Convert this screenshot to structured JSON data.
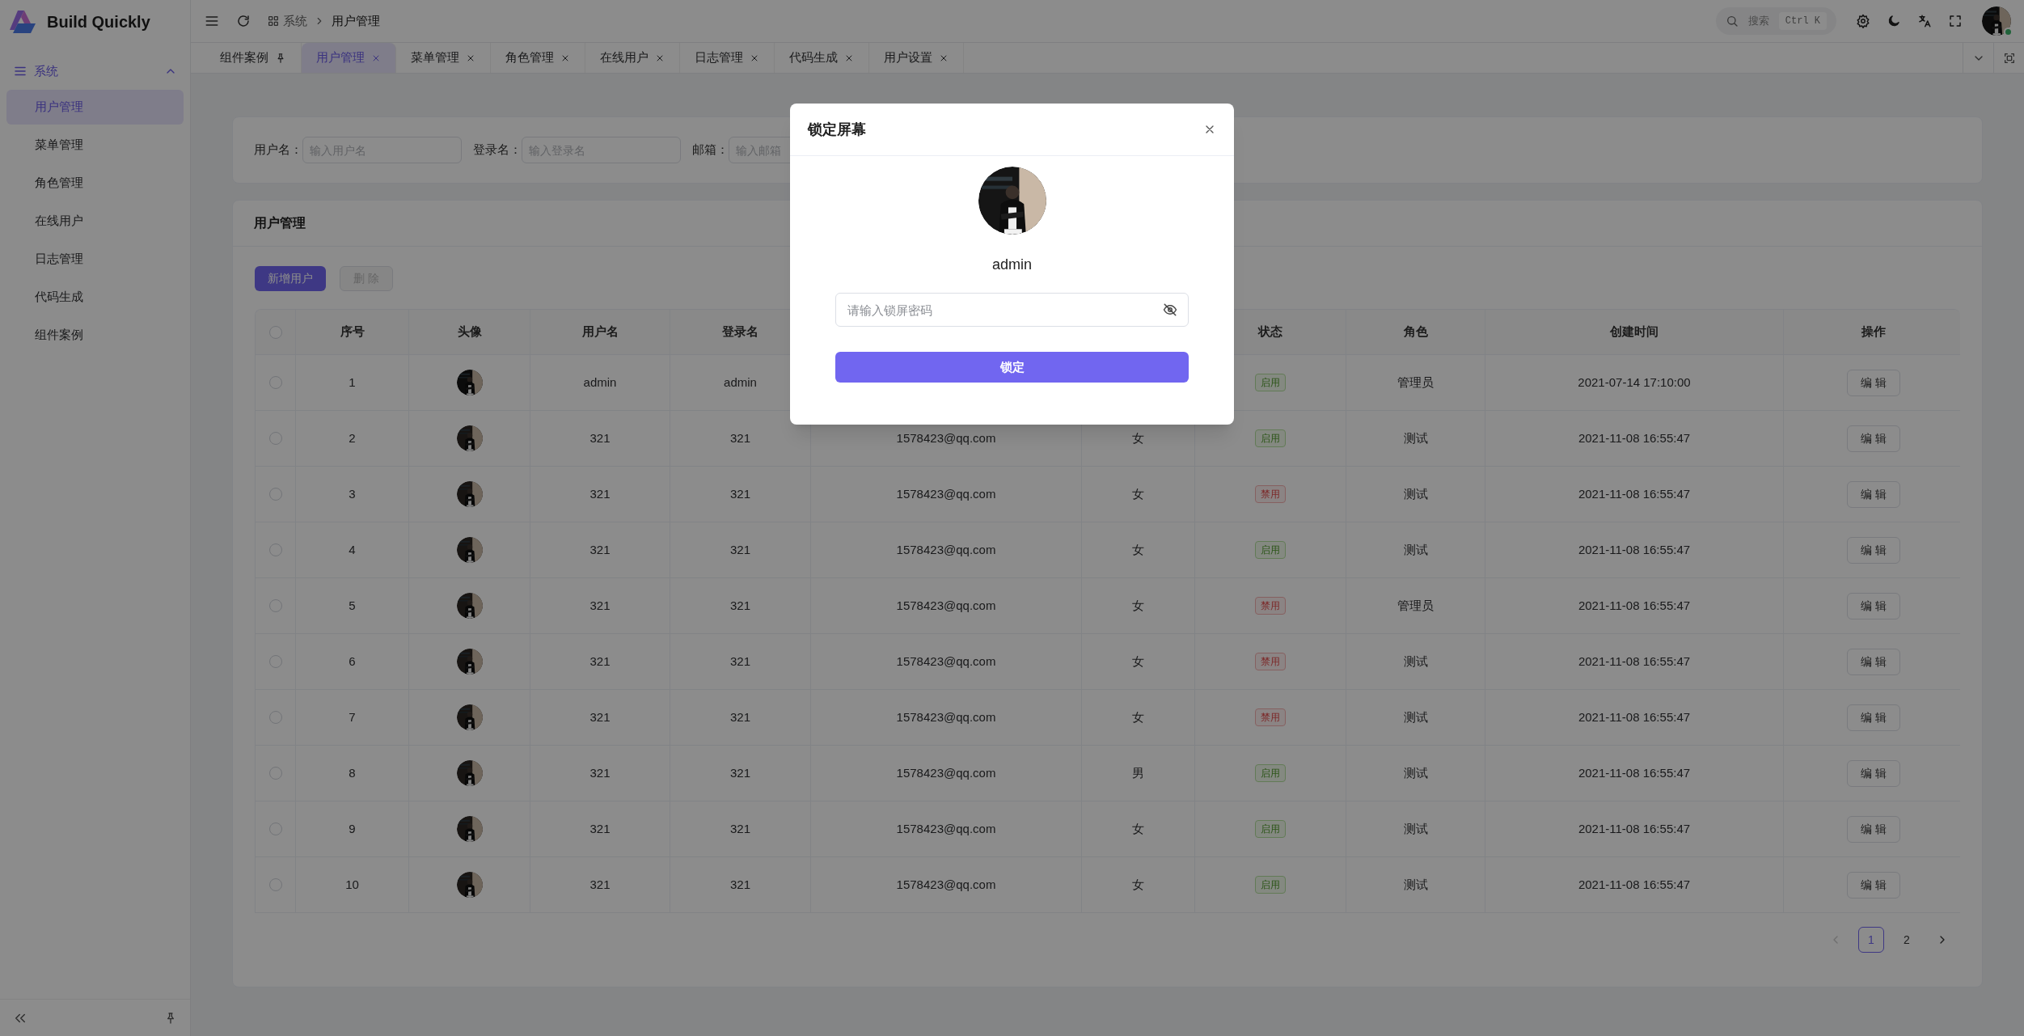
{
  "app": {
    "logo": "Build Quickly"
  },
  "topbar": {
    "breadcrumb": [
      "系统",
      "用户管理"
    ],
    "search": {
      "placeholder": "搜索",
      "shortcut": "Ctrl K"
    }
  },
  "sidebar": {
    "group": {
      "label": "系统",
      "expanded": true
    },
    "items": [
      {
        "label": "用户管理",
        "selected": true
      },
      {
        "label": "菜单管理",
        "selected": false
      },
      {
        "label": "角色管理",
        "selected": false
      },
      {
        "label": "在线用户",
        "selected": false
      },
      {
        "label": "日志管理",
        "selected": false
      },
      {
        "label": "代码生成",
        "selected": false
      },
      {
        "label": "组件案例",
        "selected": false
      }
    ]
  },
  "tabs": [
    {
      "label": "组件案例",
      "pinned": true,
      "selected": false
    },
    {
      "label": "用户管理",
      "pinned": false,
      "selected": true
    },
    {
      "label": "菜单管理",
      "pinned": false,
      "selected": false
    },
    {
      "label": "角色管理",
      "pinned": false,
      "selected": false
    },
    {
      "label": "在线用户",
      "pinned": false,
      "selected": false
    },
    {
      "label": "日志管理",
      "pinned": false,
      "selected": false
    },
    {
      "label": "代码生成",
      "pinned": false,
      "selected": false
    },
    {
      "label": "用户设置",
      "pinned": false,
      "selected": false
    }
  ],
  "filters": [
    {
      "label": "用户名：",
      "placeholder": "输入用户名"
    },
    {
      "label": "登录名：",
      "placeholder": "输入登录名"
    },
    {
      "label": "邮箱：",
      "placeholder": "输入邮箱"
    }
  ],
  "table_card": {
    "title": "用户管理",
    "buttons": [
      {
        "label": "新增用户",
        "disabled": false
      },
      {
        "label": "删 除",
        "disabled": true
      }
    ]
  },
  "table": {
    "all_checked": false,
    "columns": [
      "序号",
      "头像",
      "用户名",
      "登录名",
      null,
      null,
      "状态",
      "角色",
      "创建时间",
      "操作"
    ],
    "rows": [
      {
        "checked": false,
        "index": "1",
        "username": "admin",
        "login": "admin",
        "status": "启用",
        "enabled": true,
        "role": "管理员",
        "created": "2021-07-14 17:10:00",
        "action": "编 辑"
      },
      {
        "checked": false,
        "index": "2",
        "username": "321",
        "login": "321",
        "email": "1578423@qq.com",
        "gender": "女",
        "status": "启用",
        "enabled": true,
        "role": "测试",
        "created": "2021-11-08 16:55:47",
        "action": "编 辑"
      },
      {
        "checked": false,
        "index": "3",
        "username": "321",
        "login": "321",
        "email": "1578423@qq.com",
        "gender": "女",
        "status": "禁用",
        "enabled": false,
        "role": "测试",
        "created": "2021-11-08 16:55:47",
        "action": "编 辑"
      },
      {
        "checked": false,
        "index": "4",
        "username": "321",
        "login": "321",
        "email": "1578423@qq.com",
        "gender": "女",
        "status": "启用",
        "enabled": true,
        "role": "测试",
        "created": "2021-11-08 16:55:47",
        "action": "编 辑"
      },
      {
        "checked": false,
        "index": "5",
        "username": "321",
        "login": "321",
        "email": "1578423@qq.com",
        "gender": "女",
        "status": "禁用",
        "enabled": false,
        "role": "管理员",
        "created": "2021-11-08 16:55:47",
        "action": "编 辑"
      },
      {
        "checked": false,
        "index": "6",
        "username": "321",
        "login": "321",
        "email": "1578423@qq.com",
        "gender": "女",
        "status": "禁用",
        "enabled": false,
        "role": "测试",
        "created": "2021-11-08 16:55:47",
        "action": "编 辑"
      },
      {
        "checked": false,
        "index": "7",
        "username": "321",
        "login": "321",
        "email": "1578423@qq.com",
        "gender": "女",
        "status": "禁用",
        "enabled": false,
        "role": "测试",
        "created": "2021-11-08 16:55:47",
        "action": "编 辑"
      },
      {
        "checked": false,
        "index": "8",
        "username": "321",
        "login": "321",
        "email": "1578423@qq.com",
        "gender": "男",
        "status": "启用",
        "enabled": true,
        "role": "测试",
        "created": "2021-11-08 16:55:47",
        "action": "编 辑"
      },
      {
        "checked": false,
        "index": "9",
        "username": "321",
        "login": "321",
        "email": "1578423@qq.com",
        "gender": "女",
        "status": "启用",
        "enabled": true,
        "role": "测试",
        "created": "2021-11-08 16:55:47",
        "action": "编 辑"
      },
      {
        "checked": false,
        "index": "10",
        "username": "321",
        "login": "321",
        "email": "1578423@qq.com",
        "gender": "女",
        "status": "启用",
        "enabled": true,
        "role": "测试",
        "created": "2021-11-08 16:55:47",
        "action": "编 辑"
      }
    ]
  },
  "pagination": {
    "prev_disabled": true,
    "next_disabled": false,
    "pages": [
      {
        "label": "1",
        "selected": true
      },
      {
        "label": "2",
        "selected": false
      }
    ]
  },
  "modal": {
    "title": "锁定屏幕",
    "username": "admin",
    "password": {
      "placeholder": "请输入锁屏密码"
    },
    "submit": "锁定"
  }
}
